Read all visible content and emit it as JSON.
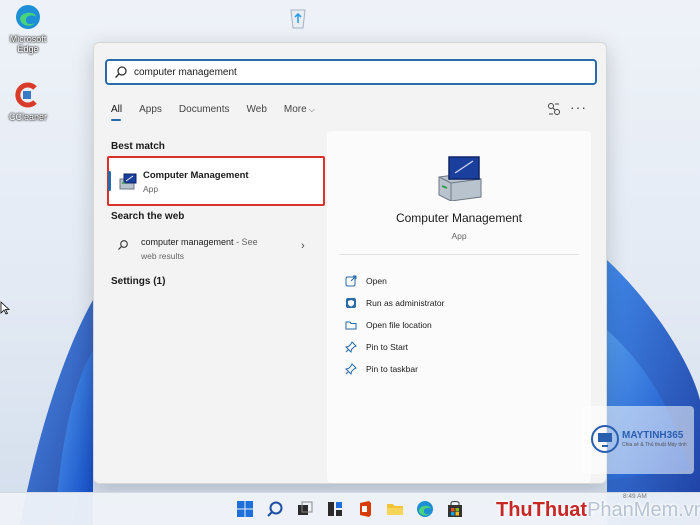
{
  "desktop": {
    "icons": [
      {
        "name": "edge",
        "label": "Microsoft Edge"
      },
      {
        "name": "ccleaner",
        "label": "CCleaner"
      },
      {
        "name": "recycle-bin",
        "label": ""
      }
    ]
  },
  "search": {
    "query": "computer management"
  },
  "tabs": [
    {
      "label": "All",
      "active": true
    },
    {
      "label": "Apps"
    },
    {
      "label": "Documents"
    },
    {
      "label": "Web"
    },
    {
      "label": "More"
    }
  ],
  "best_match": {
    "title": "Best match",
    "name": "Computer Management",
    "type": "App"
  },
  "search_web": {
    "title": "Search the web",
    "query": "computer management",
    "suffix": " - See",
    "line2": "web results"
  },
  "settings": {
    "title": "Settings (1)"
  },
  "detail": {
    "name": "Computer Management",
    "type": "App",
    "actions": [
      {
        "label": "Open",
        "icon": "open-icon"
      },
      {
        "label": "Run as administrator",
        "icon": "shield-icon"
      },
      {
        "label": "Open file location",
        "icon": "folder-icon"
      },
      {
        "label": "Pin to Start",
        "icon": "pin-icon"
      },
      {
        "label": "Pin to taskbar",
        "icon": "pin-icon"
      }
    ]
  },
  "watermark": {
    "brand": "MAYTINH365",
    "tagline": "Chia sẻ & Thủ thuật Máy tính",
    "clock": "8:49 AM"
  },
  "site_watermark": {
    "red": "ThuThuat",
    "faint": "PhanMem.vn"
  },
  "colors": {
    "accent": "#2a6aa8",
    "highlight_border": "#d9312c",
    "panel_bg": "#f3f3f3"
  }
}
